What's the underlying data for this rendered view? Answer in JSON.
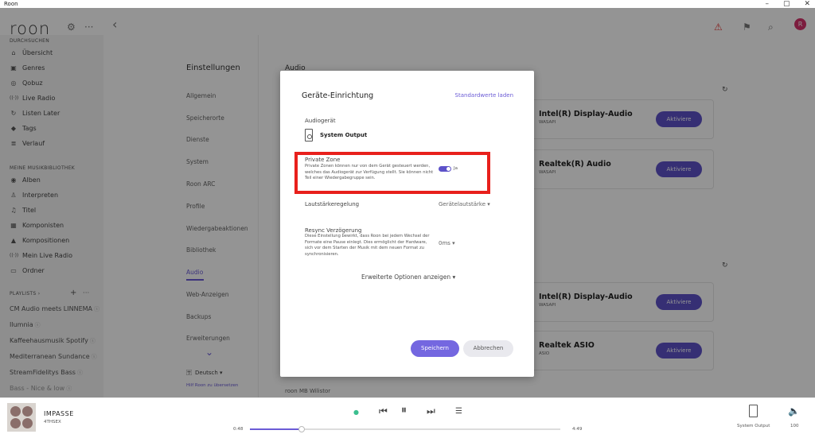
{
  "window": {
    "title": "Roon",
    "min": "–",
    "max": "▢",
    "close": "✕"
  },
  "header": {
    "logo": "roon",
    "settings_icon": "gear-icon",
    "more": "···",
    "back": "‹",
    "avatar": "R"
  },
  "sidebar": {
    "browse_section": "DURCHSUCHEN",
    "browse": [
      {
        "label": "Übersicht",
        "icon": "⌂"
      },
      {
        "label": "Genres",
        "icon": "▣"
      },
      {
        "label": "Qobuz",
        "icon": "◎"
      },
      {
        "label": "Live Radio",
        "icon": "((·))"
      },
      {
        "label": "Listen Later",
        "icon": "↻"
      },
      {
        "label": "Tags",
        "icon": "◆"
      },
      {
        "label": "Verlauf",
        "icon": "≣"
      }
    ],
    "library_section": "MEINE MUSIKBIBLIOTHEK",
    "library": [
      {
        "label": "Alben",
        "icon": "◉"
      },
      {
        "label": "Interpreten",
        "icon": "♙"
      },
      {
        "label": "Titel",
        "icon": "♫"
      },
      {
        "label": "Komponisten",
        "icon": "▦"
      },
      {
        "label": "Kompositionen",
        "icon": "▲"
      },
      {
        "label": "Mein Live Radio",
        "icon": "((·))"
      },
      {
        "label": "Ordner",
        "icon": "▭"
      }
    ],
    "playlists_section": "PLAYLISTS ›",
    "playlists_add": "+",
    "playlists_more": "···",
    "playlists": [
      "CM Audio meets LINNEMA",
      "Ilumnia",
      "Kaffeehausmusik Spotify",
      "Mediterranean Sundance",
      "StreamFidelitys Bass",
      "Bass - Nice & low"
    ]
  },
  "settings": {
    "title": "Einstellungen",
    "items": [
      "Allgemein",
      "Speicherorte",
      "Dienste",
      "System",
      "Roon ARC",
      "Profile",
      "Wiedergabeaktionen",
      "Bibliothek",
      "Audio",
      "Web-Anzeigen",
      "Backups",
      "Erweiterungen"
    ],
    "active": "Audio",
    "chevron": "⌄",
    "language": "Deutsch ▾",
    "language_help": "Hilf Roon zu übersetzen"
  },
  "main": {
    "title": "Audio",
    "devices": [
      {
        "name": "Intel(R) Display-Audio",
        "sub": "WASAPI",
        "button": "Aktiviere"
      },
      {
        "name": "Realtek(R) Audio",
        "sub": "WASAPI",
        "button": "Aktiviere"
      },
      {
        "name": "Intel(R) Display-Audio",
        "sub": "WASAPI",
        "button": "Aktiviere"
      },
      {
        "name": "Realtek ASIO",
        "sub": "ASIO",
        "button": "Aktiviere"
      }
    ],
    "footer_text": "roon  MB Wilistor"
  },
  "modal": {
    "title": "Geräte-Einrichtung",
    "defaults_link": "Standardwerte laden",
    "device_label": "Audiogerät",
    "device_name": "System Output",
    "private_title": "Private Zone",
    "private_desc": "Private Zonen können nur von dem Gerät gesteuert werden, welches das Audiogerät zur Verfügung stellt. Sie können nicht Teil einer Wiedergabegruppe sein.",
    "private_value": "Ja",
    "volume_label": "Lautstärkeregelung",
    "volume_value": "Gerätelautstärke ▾",
    "resync_title": "Resync Verzögerung",
    "resync_desc": "Diese Einstellung bewirkt, dass Roon bei jedem Wechsel der Formate eine Pause einlegt. Dies ermöglicht der Hardware, sich vor dem Starten der Musik mit dem neuen Format zu synchronisieren.",
    "resync_value": "0ms ▾",
    "advanced": "Erweiterte Optionen anzeigen ▾",
    "save": "Speichern",
    "cancel": "Abbrechen"
  },
  "player": {
    "track": "IMPASSE",
    "artist": "4THSEX",
    "elapsed": "0:48",
    "total": "4:49",
    "progress_fraction": 0.166,
    "zone": "System Output",
    "volume": "100"
  },
  "colors": {
    "accent": "#6b5bd6",
    "highlight": "#e8201c",
    "alert": "#e53935",
    "avatar": "#d6336c"
  }
}
